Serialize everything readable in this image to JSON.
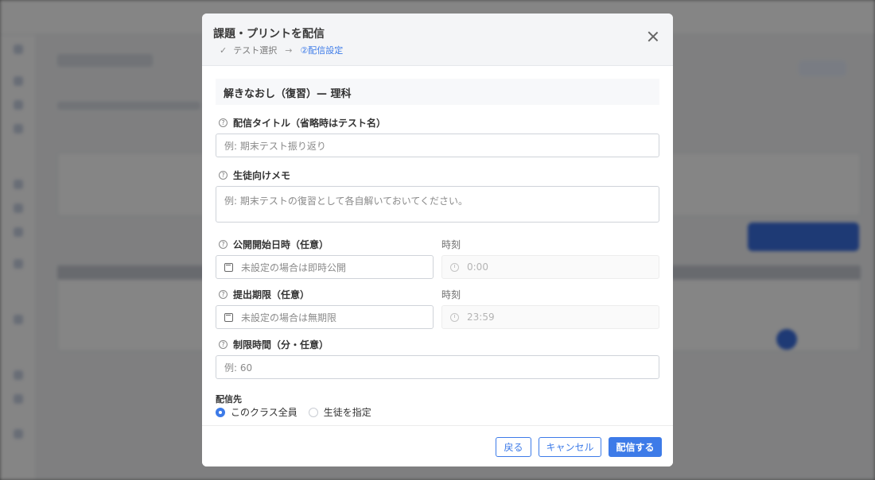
{
  "modal": {
    "title": "課題・プリントを配信",
    "steps": {
      "step1": "テスト選択",
      "arrow": "→",
      "step2": "②配信設定"
    },
    "section_title": "解きなおし（復習）— 理科"
  },
  "form": {
    "delivery_title": {
      "label": "配信タイトル（省略時はテスト名）",
      "placeholder": "例: 期末テスト振り返り"
    },
    "student_memo": {
      "label": "生徒向けメモ",
      "placeholder": "例: 期末テストの復習として各自解いておいてください。"
    },
    "publish_start": {
      "label": "公開開始日時（任意）",
      "placeholder": "未設定の場合は即時公開",
      "time_label": "時刻",
      "time_value": "0:00"
    },
    "due": {
      "label": "提出期限（任意）",
      "placeholder": "未設定の場合は無期限",
      "time_label": "時刻",
      "time_value": "23:59"
    },
    "time_limit": {
      "label": "制限時間（分・任意）",
      "placeholder": "例: 60"
    },
    "target": {
      "label": "配信先",
      "options": [
        "このクラス全員",
        "生徒を指定"
      ],
      "selected": "このクラス全員"
    }
  },
  "footer": {
    "back": "戻る",
    "cancel": "キャンセル",
    "submit": "配信する"
  },
  "colors": {
    "accent": "#3d7be8",
    "overlay": "#7d7d7d"
  }
}
